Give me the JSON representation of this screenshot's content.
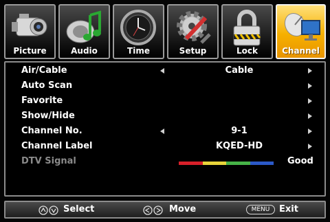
{
  "tabs": [
    {
      "label": "Picture",
      "icon": "camcorder-icon"
    },
    {
      "label": "Audio",
      "icon": "music-note-icon"
    },
    {
      "label": "Time",
      "icon": "clock-icon"
    },
    {
      "label": "Setup",
      "icon": "gear-wrench-icon"
    },
    {
      "label": "Lock",
      "icon": "padlock-icon"
    },
    {
      "label": "Channel",
      "icon": "satellite-dish-icon",
      "active": true
    }
  ],
  "menu": {
    "rows": [
      {
        "name": "Air/Cable",
        "value": "Cable"
      },
      {
        "name": "Auto Scan",
        "value": ""
      },
      {
        "name": "Favorite",
        "value": ""
      },
      {
        "name": "Show/Hide",
        "value": ""
      },
      {
        "name": "Channel No.",
        "value": "9-1"
      },
      {
        "name": "Channel Label",
        "value": "KQED-HD"
      },
      {
        "name": "DTV Signal",
        "value": "Good"
      }
    ],
    "signal_colors": [
      "#d8202a",
      "#e8d43a",
      "#46b347",
      "#2b59c8"
    ]
  },
  "help": {
    "select": "Select",
    "move": "Move",
    "menu_key": "MENU",
    "exit": "Exit"
  },
  "colors": {
    "active_tab": "#f6b000",
    "text": "#ffffff",
    "disabled_text": "#8a8a8a"
  }
}
